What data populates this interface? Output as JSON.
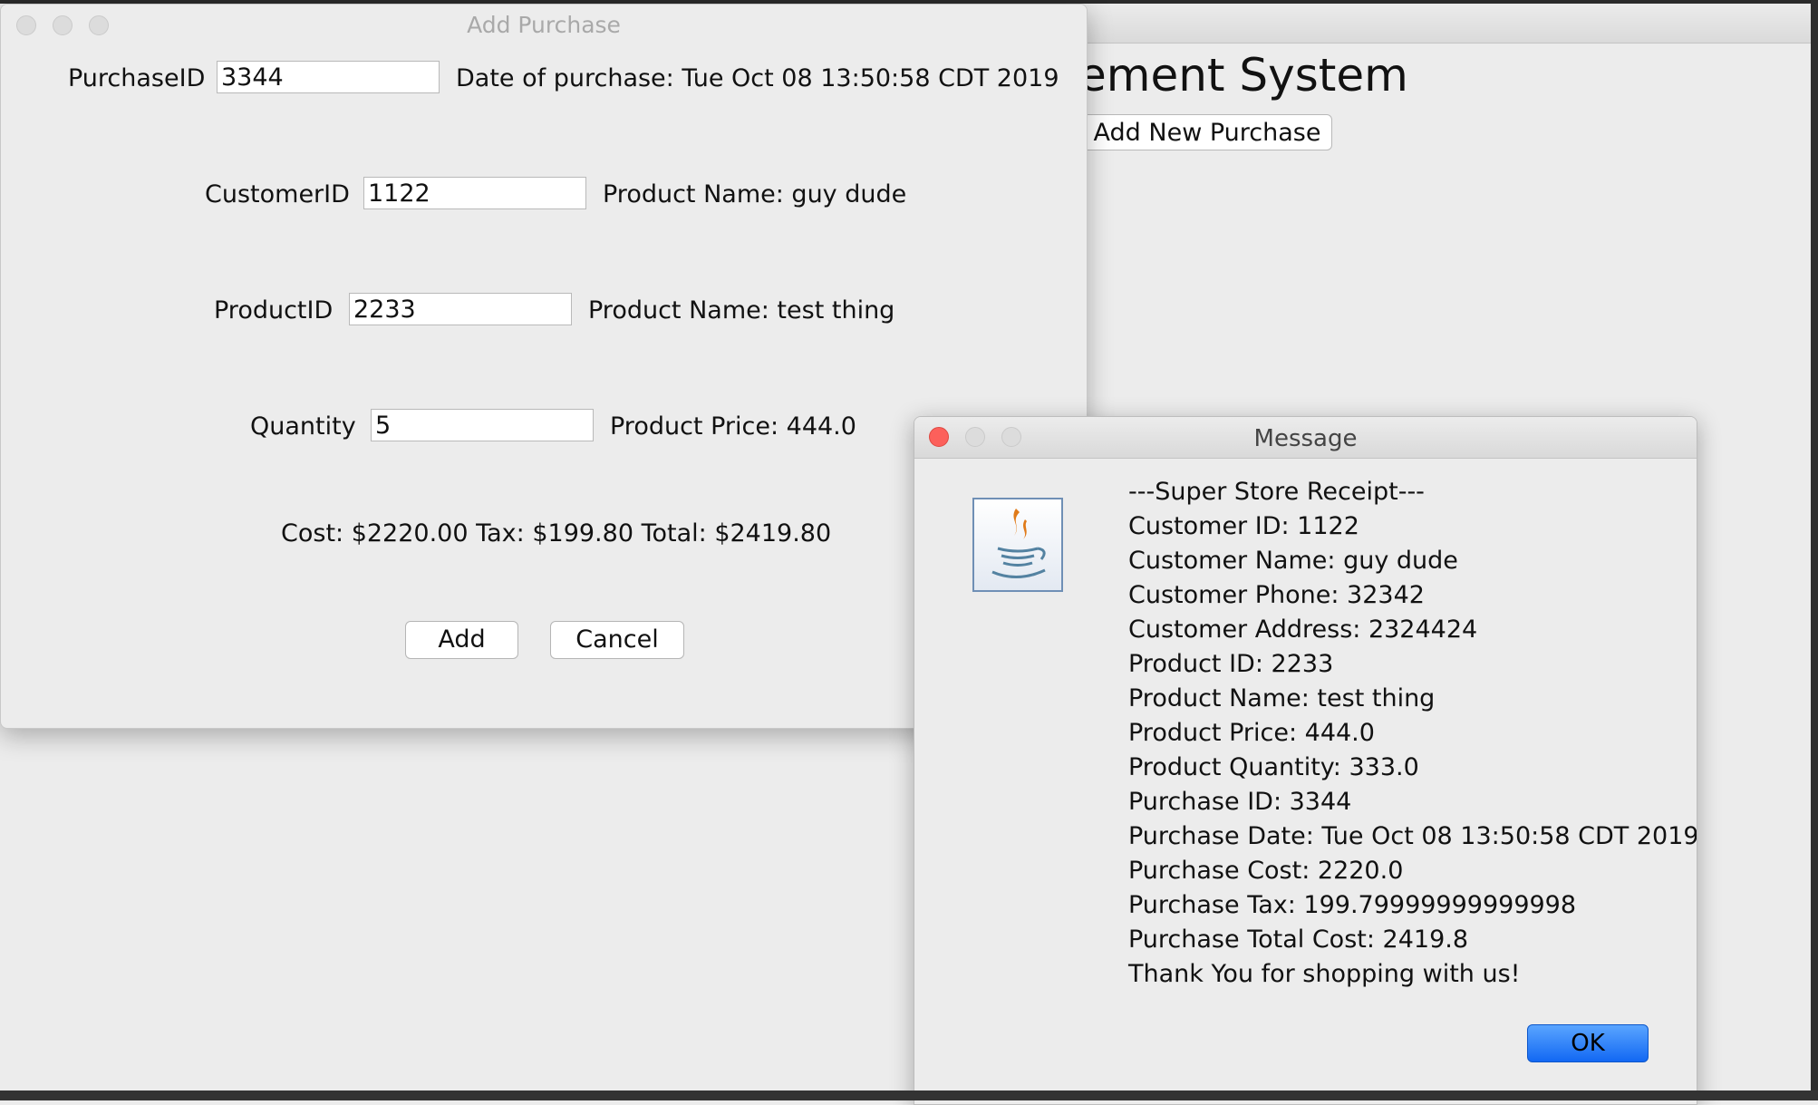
{
  "main_window": {
    "heading": "ement System",
    "add_new_purchase": "Add New Purchase"
  },
  "add_purchase": {
    "title": "Add Purchase",
    "purchase_id_label": "PurchaseID",
    "purchase_id_value": "3344",
    "date_text": "Date of purchase: Tue Oct 08 13:50:58 CDT 2019",
    "customer_id_label": "CustomerID",
    "customer_id_value": "1122",
    "customer_name_text": "Product Name: guy dude",
    "product_id_label": "ProductID",
    "product_id_value": "2233",
    "product_name_text": "Product Name: test thing",
    "quantity_label": "Quantity",
    "quantity_value": "5",
    "product_price_text": "Product Price: 444.0",
    "totals_text": "Cost: $2220.00 Tax: $199.80 Total: $2419.80",
    "add_button": "Add",
    "cancel_button": "Cancel"
  },
  "message": {
    "title": "Message",
    "lines": [
      "---Super Store Receipt---",
      "Customer ID: 1122",
      "Customer Name: guy dude",
      "Customer Phone: 32342",
      "Customer Address: 2324424",
      "Product ID: 2233",
      "Product Name: test thing",
      "Product Price: 444.0",
      "Product Quantity: 333.0",
      "Purchase ID: 3344",
      "Purchase Date: Tue Oct 08 13:50:58 CDT 2019",
      "Purchase Cost: 2220.0",
      "Purchase Tax: 199.79999999999998",
      "Purchase Total Cost: 2419.8",
      "Thank You for shopping with us!"
    ],
    "ok_button": "OK",
    "icon": "java-cup-icon"
  },
  "colors": {
    "close_red": "#fc605b",
    "ok_blue": "#1a73f5",
    "window_bg": "#ececec"
  }
}
